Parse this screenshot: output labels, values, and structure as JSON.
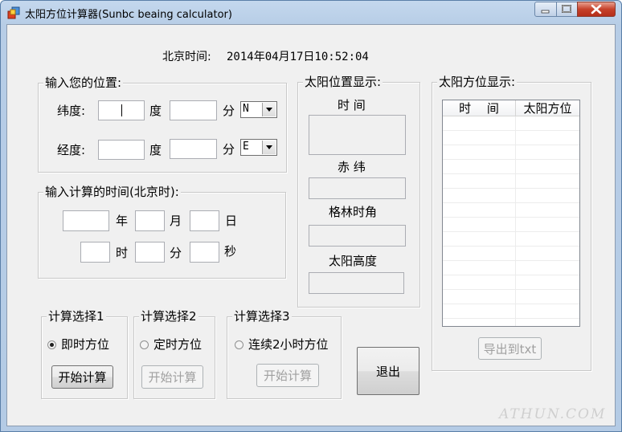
{
  "window": {
    "title": "太阳方位计算器(Sunbc beaing calculator)",
    "colors": {
      "frame": "#b4cbe5",
      "client": "#f0f0f0",
      "close": "#c6412a"
    }
  },
  "beijing_time": {
    "label": "北京时间:",
    "value": "2014年04月17日10:52:04"
  },
  "position_group": {
    "legend": "输入您的位置:",
    "latitude": {
      "label": "纬度:",
      "deg_value": "",
      "deg_unit": "度",
      "min_value": "",
      "min_unit": "分",
      "hemisphere": "N"
    },
    "longitude": {
      "label": "经度:",
      "deg_value": "",
      "deg_unit": "度",
      "min_value": "",
      "min_unit": "分",
      "hemisphere": "E"
    }
  },
  "calc_time_group": {
    "legend": "输入计算的时间(北京时):",
    "year_unit": "年",
    "month_unit": "月",
    "day_unit": "日",
    "hour_unit": "时",
    "minute_unit": "分",
    "second_unit": "秒",
    "year": "",
    "month": "",
    "day": "",
    "hour": "",
    "minute": "",
    "second": ""
  },
  "sun_position_group": {
    "legend": "太阳位置显示:",
    "time_label": "时 间",
    "declination_label": "赤 纬",
    "hour_angle_label": "格林时角",
    "altitude_label": "太阳高度",
    "time_value": "",
    "declination_value": "",
    "hour_angle_value": "",
    "altitude_value": ""
  },
  "azimuth_group": {
    "legend": "太阳方位显示:",
    "columns": [
      "时　 间",
      "太阳方位"
    ],
    "rows": [],
    "export_button": "导出到txt"
  },
  "calc_options": [
    {
      "legend": "计算选择1",
      "radio_label": "即时方位",
      "checked": true,
      "button": "开始计算",
      "enabled": true
    },
    {
      "legend": "计算选择2",
      "radio_label": "定时方位",
      "checked": false,
      "button": "开始计算",
      "enabled": false
    },
    {
      "legend": "计算选择3",
      "radio_label": "连续2小时方位",
      "checked": false,
      "button": "开始计算",
      "enabled": false
    }
  ],
  "exit_button": "退出",
  "watermark": "ATHUN.COM"
}
